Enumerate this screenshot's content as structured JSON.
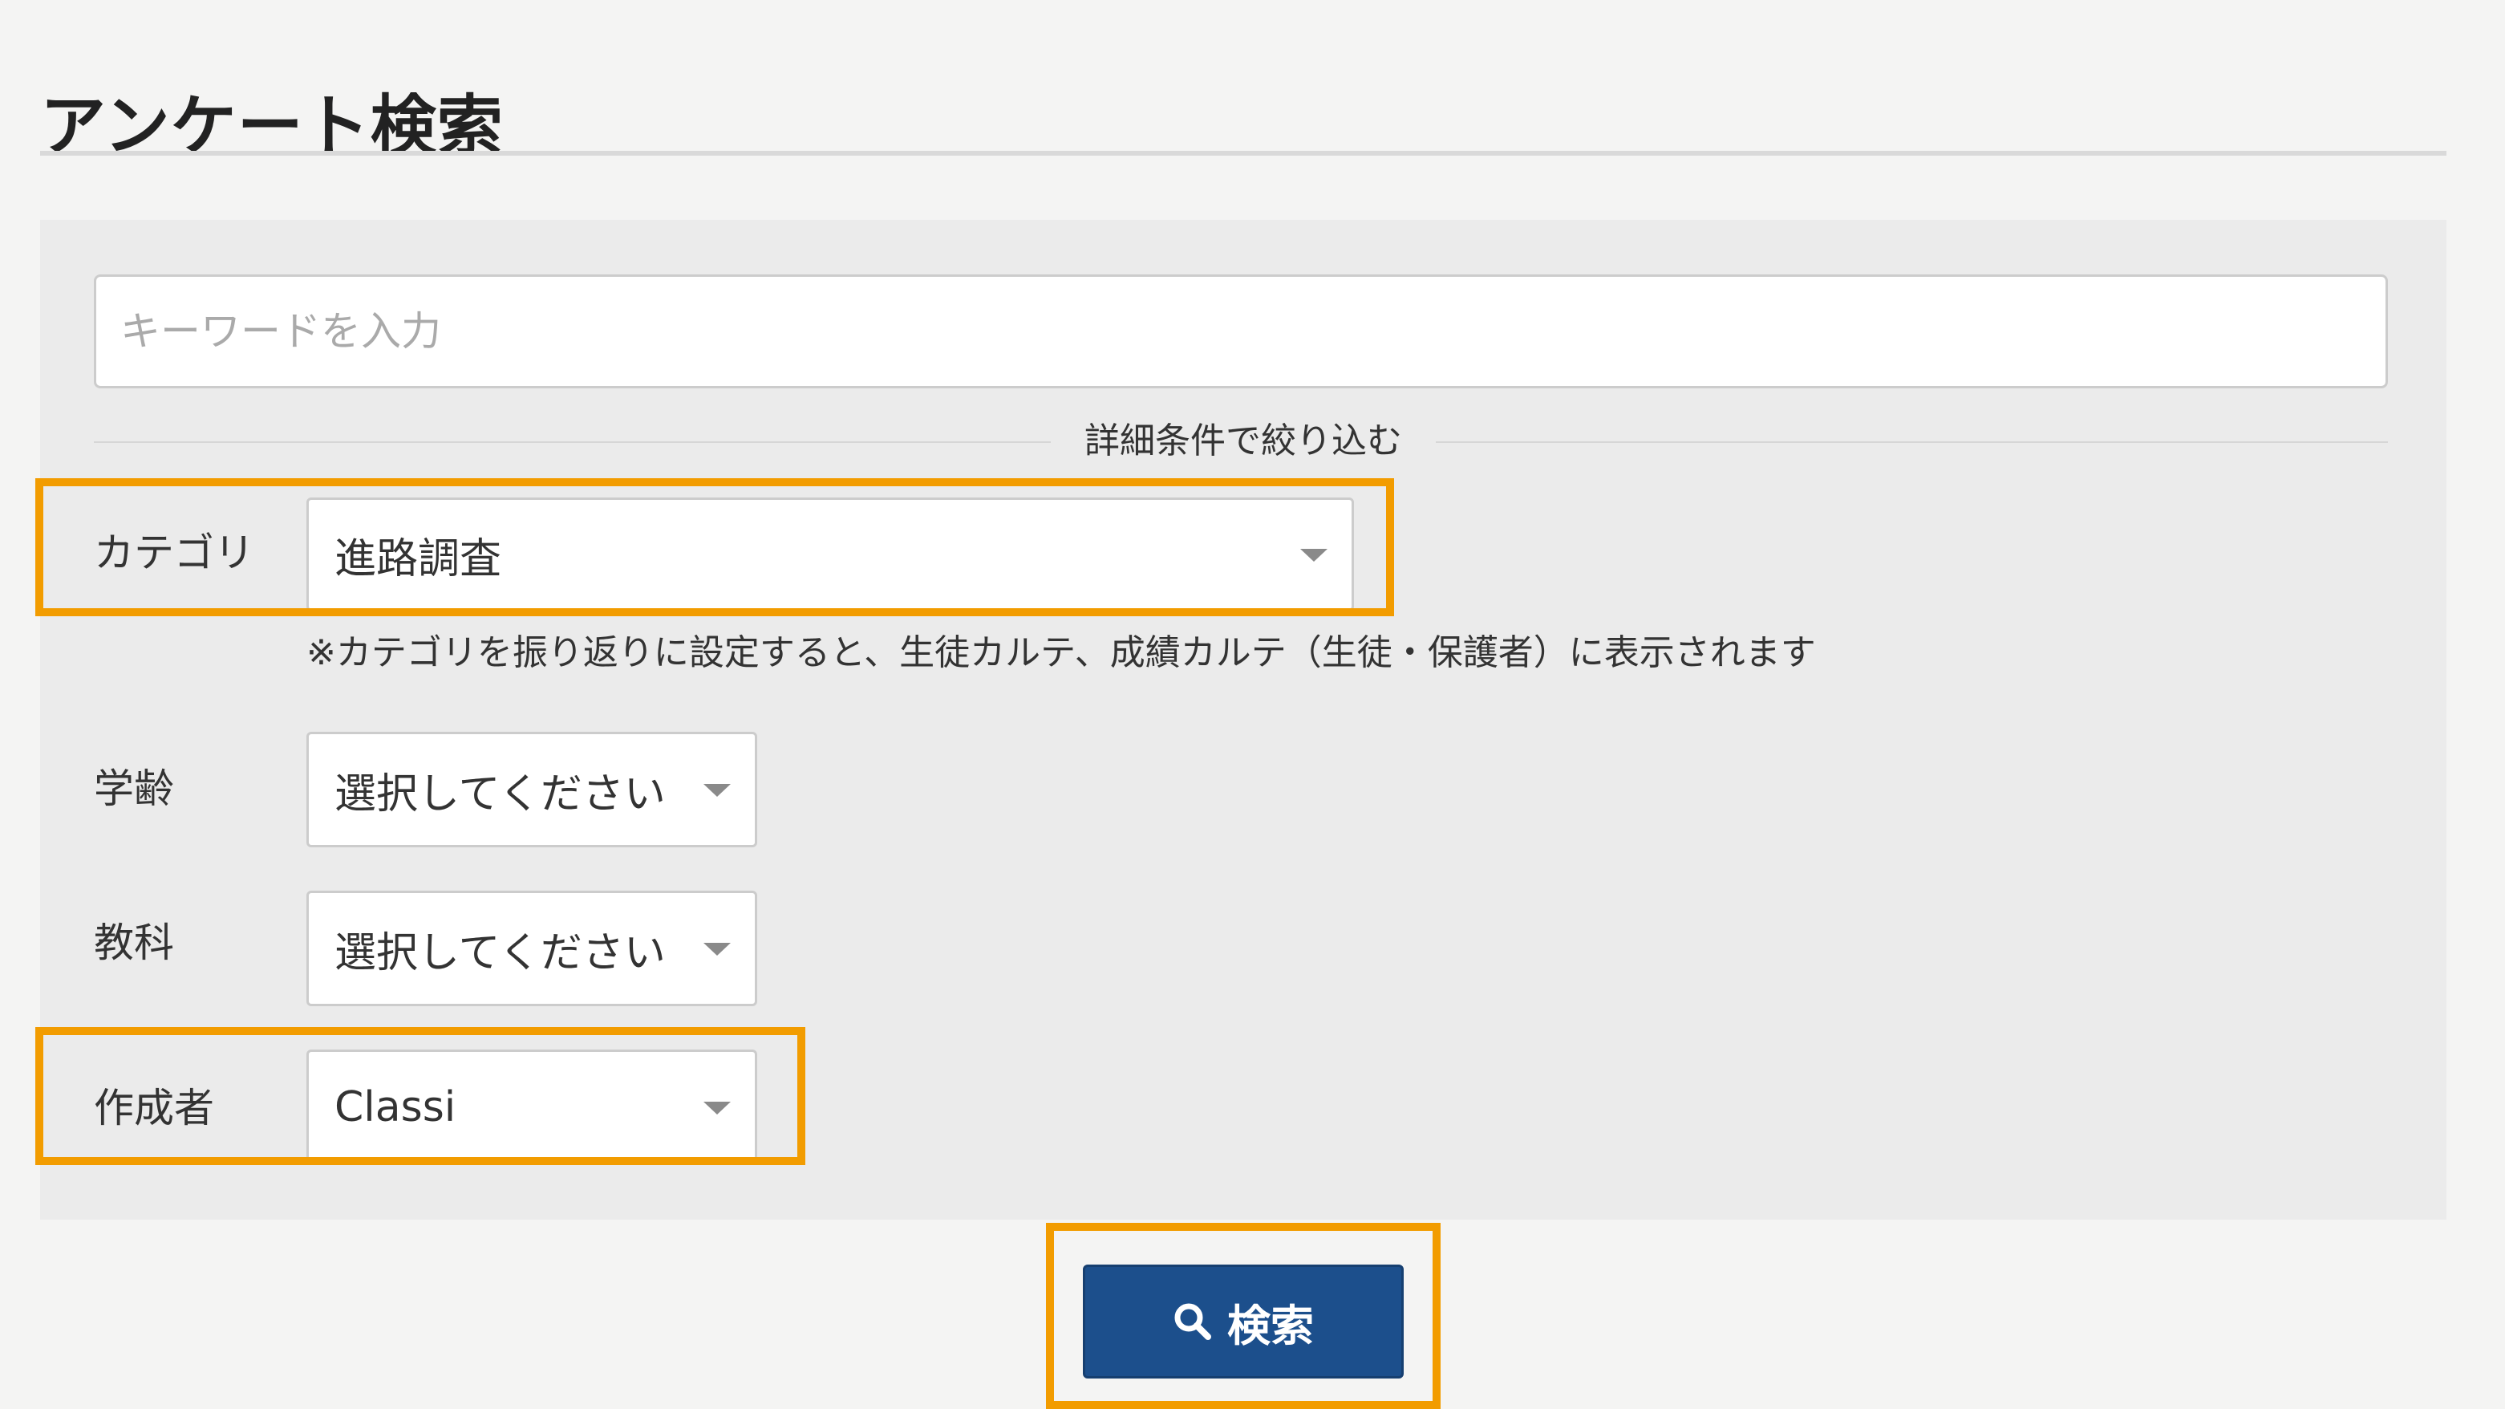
{
  "page": {
    "title": "アンケート検索"
  },
  "search": {
    "keyword_placeholder": "キーワードを入力",
    "keyword_value": "",
    "filter_divider": "詳細条件で絞り込む"
  },
  "filters": {
    "category": {
      "label": "カテゴリ",
      "value": "進路調査",
      "note": "※カテゴリを振り返りに設定すると、生徒カルテ、成績カルテ（生徒・保護者）に表示されます"
    },
    "grade": {
      "label": "学齢",
      "value": "選択してください"
    },
    "subject": {
      "label": "教科",
      "value": "選択してください"
    },
    "author": {
      "label": "作成者",
      "value": "Classi"
    }
  },
  "actions": {
    "search_label": "検索"
  },
  "icons": {
    "search": "search-icon",
    "dropdown": "chevron-down-icon"
  },
  "colors": {
    "highlight": "#f29c00",
    "button": "#1c4f8c",
    "panel": "#ebebeb"
  }
}
